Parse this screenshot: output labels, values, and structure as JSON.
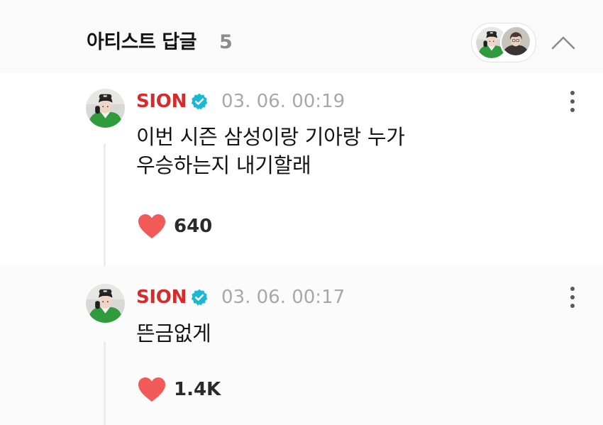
{
  "header": {
    "title": "아티스트 답글",
    "count": "5",
    "avatar_icons": [
      "artist-avatar-icon",
      "artist-avatar-icon"
    ],
    "collapse_icon": "chevron-up-icon"
  },
  "comments": [
    {
      "author": "SION",
      "verified_icon": "verified-badge-icon",
      "timestamp": "03. 06. 00:19",
      "lines": [
        "이번 시즌 삼성이랑 기아랑 누가",
        "우승하는지 내기할래"
      ],
      "likes": "640",
      "like_icon": "heart-icon",
      "more_icon": "more-vertical-icon"
    },
    {
      "author": "SION",
      "verified_icon": "verified-badge-icon",
      "timestamp": "03. 06. 00:17",
      "lines": [
        "뜬금없게"
      ],
      "likes": "1.4K",
      "like_icon": "heart-icon",
      "more_icon": "more-vertical-icon"
    }
  ],
  "colors": {
    "author": "#d62b2b",
    "verified": "#19b9d6",
    "heart": "#f25a5a",
    "timestamp": "#a8a8a8",
    "header_count": "#8c8c8c"
  }
}
